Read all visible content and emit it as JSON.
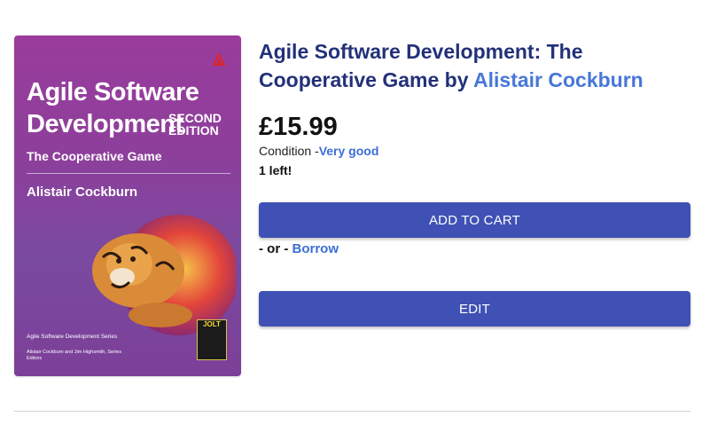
{
  "book": {
    "title_text": "Agile Software Development: The Cooperative Game",
    "by_text": " by ",
    "author": "Alistair Cockburn",
    "price": "£15.99",
    "condition_label": "Condition -",
    "condition_value": "Very good",
    "stock_text": "1 left!"
  },
  "actions": {
    "add_to_cart_label": "ADD TO CART",
    "or_prefix": "- or - ",
    "borrow_label": "Borrow",
    "edit_label": "EDIT"
  },
  "cover": {
    "title": "Agile Software Development",
    "edition": "SECOND EDITION",
    "subtitle": "The Cooperative Game",
    "author": "Alistair Cockburn",
    "series": "Agile Software Development Series",
    "editors": "Alistair Cockburn and Jim Highsmith, Series Editors",
    "award": "JOLT",
    "background_color": "#8d3f9b"
  },
  "colors": {
    "title": "#233179",
    "link": "#4777d8",
    "button": "#3f51b5"
  }
}
